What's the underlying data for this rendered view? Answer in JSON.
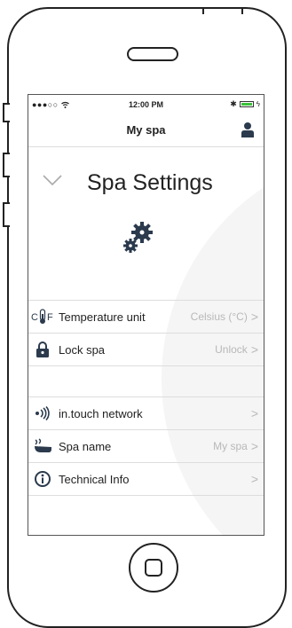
{
  "status_bar": {
    "signal": "●●●○○",
    "time": "12:00 PM"
  },
  "nav": {
    "title": "My spa"
  },
  "page": {
    "title": "Spa Settings"
  },
  "settings_group_1": [
    {
      "label": "Temperature unit",
      "value": "Celsius (°C)",
      "icon": "temperature-unit-icon"
    },
    {
      "label": "Lock spa",
      "value": "Unlock",
      "icon": "lock-icon"
    }
  ],
  "settings_group_2": [
    {
      "label": "in.touch network",
      "value": "",
      "icon": "network-icon"
    },
    {
      "label": "Spa name",
      "value": "My spa",
      "icon": "spa-name-icon"
    },
    {
      "label": "Technical Info",
      "value": "",
      "icon": "info-icon"
    }
  ],
  "colors": {
    "accent": "#2b3a4d",
    "muted": "#b8b8b8",
    "battery": "#3cc13c"
  }
}
